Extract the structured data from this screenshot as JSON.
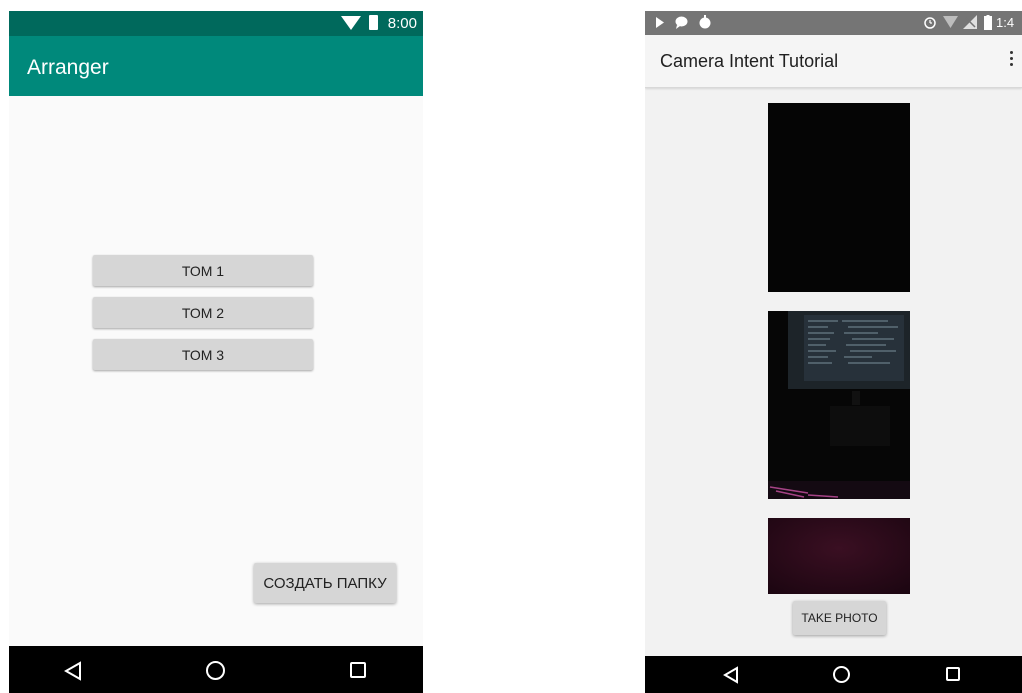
{
  "left_app": {
    "status_time": "8:00",
    "title": "Arranger",
    "volume_buttons": [
      "ТОМ 1",
      "ТОМ 2",
      "ТОМ 3"
    ],
    "create_folder_label": "СОЗДАТЬ ПАПКУ",
    "nav": [
      "back-icon",
      "home-icon",
      "recents-icon"
    ],
    "colors": {
      "statusbar": "#00695c",
      "appbar": "#00897b"
    }
  },
  "right_app": {
    "status_time": "1:4",
    "status_icons_left": [
      "play-icon",
      "chat-bubble-icon",
      "android-icon"
    ],
    "status_icons_right": [
      "alarm-icon",
      "wifi-icon",
      "no-signal-icon",
      "battery-icon"
    ],
    "title": "Camera Intent Tutorial",
    "menu_icon": "overflow-menu-icon",
    "photos": [
      "photo-dark",
      "photo-monitor",
      "photo-purple"
    ],
    "take_photo_label": "TAKE PHOTO",
    "nav": [
      "back-icon",
      "home-icon",
      "recents-icon"
    ]
  }
}
